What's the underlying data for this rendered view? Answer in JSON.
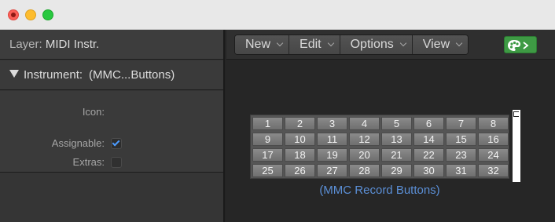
{
  "inspector": {
    "layer_label": "Layer:",
    "layer_value": "MIDI Instr.",
    "instrument_label": "Instrument:",
    "instrument_value": "(MMC...Buttons)",
    "icon_label": "Icon:",
    "assignable_label": "Assignable:",
    "assignable_checked": true,
    "extras_label": "Extras:",
    "extras_checked": false
  },
  "toolbar": {
    "menus": [
      {
        "label": "New"
      },
      {
        "label": "Edit"
      },
      {
        "label": "Options"
      },
      {
        "label": "View"
      }
    ],
    "accent": "#3e9a44"
  },
  "mmc_grid": {
    "buttons": [
      "1",
      "2",
      "3",
      "4",
      "5",
      "6",
      "7",
      "8",
      "9",
      "10",
      "11",
      "12",
      "13",
      "14",
      "15",
      "16",
      "17",
      "18",
      "19",
      "20",
      "21",
      "22",
      "23",
      "24",
      "25",
      "26",
      "27",
      "28",
      "29",
      "30",
      "31",
      "32"
    ],
    "caption": "(MMC Record Buttons)"
  }
}
